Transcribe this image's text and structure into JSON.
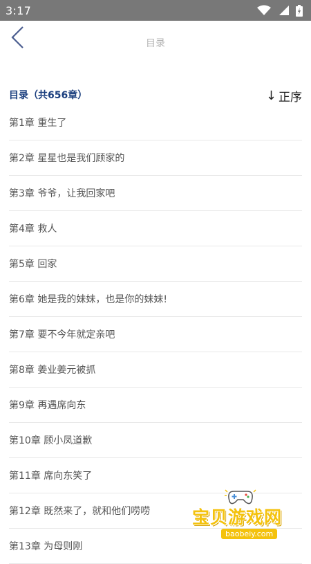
{
  "status_bar": {
    "time": "3:17",
    "icons": [
      "wifi-icon",
      "cellular-signal-icon",
      "battery-icon"
    ]
  },
  "header": {
    "title": "目录",
    "back_icon": "chevron-left-icon"
  },
  "toc": {
    "count_label": "目录（共656章）",
    "sort_arrow": "↓",
    "sort_label": "正序"
  },
  "chapters": [
    "第1章 重生了",
    "第2章 星星也是我们顾家的",
    "第3章 爷爷，让我回家吧",
    "第4章 救人",
    "第5章 回家",
    "第6章 她是我的妹妹，也是你的妹妹!",
    "第7章 要不今年就定亲吧",
    "第8章 姜业姜元被抓",
    "第9章 再遇席向东",
    "第10章 顾小凤道歉",
    "第11章 席向东笑了",
    "第12章 既然来了，就和他们唠唠",
    "第13章 为母则刚"
  ],
  "watermark": {
    "text": "宝贝游戏网",
    "domain": "baobeiy.com"
  },
  "colors": {
    "status_bar": "#787878",
    "accent_blue": "#1a3e7e",
    "back_arrow": "#4a5d8f",
    "chapter_text": "#555555",
    "divider": "#e8e8e8",
    "watermark_yellow": "#f4c20d"
  }
}
